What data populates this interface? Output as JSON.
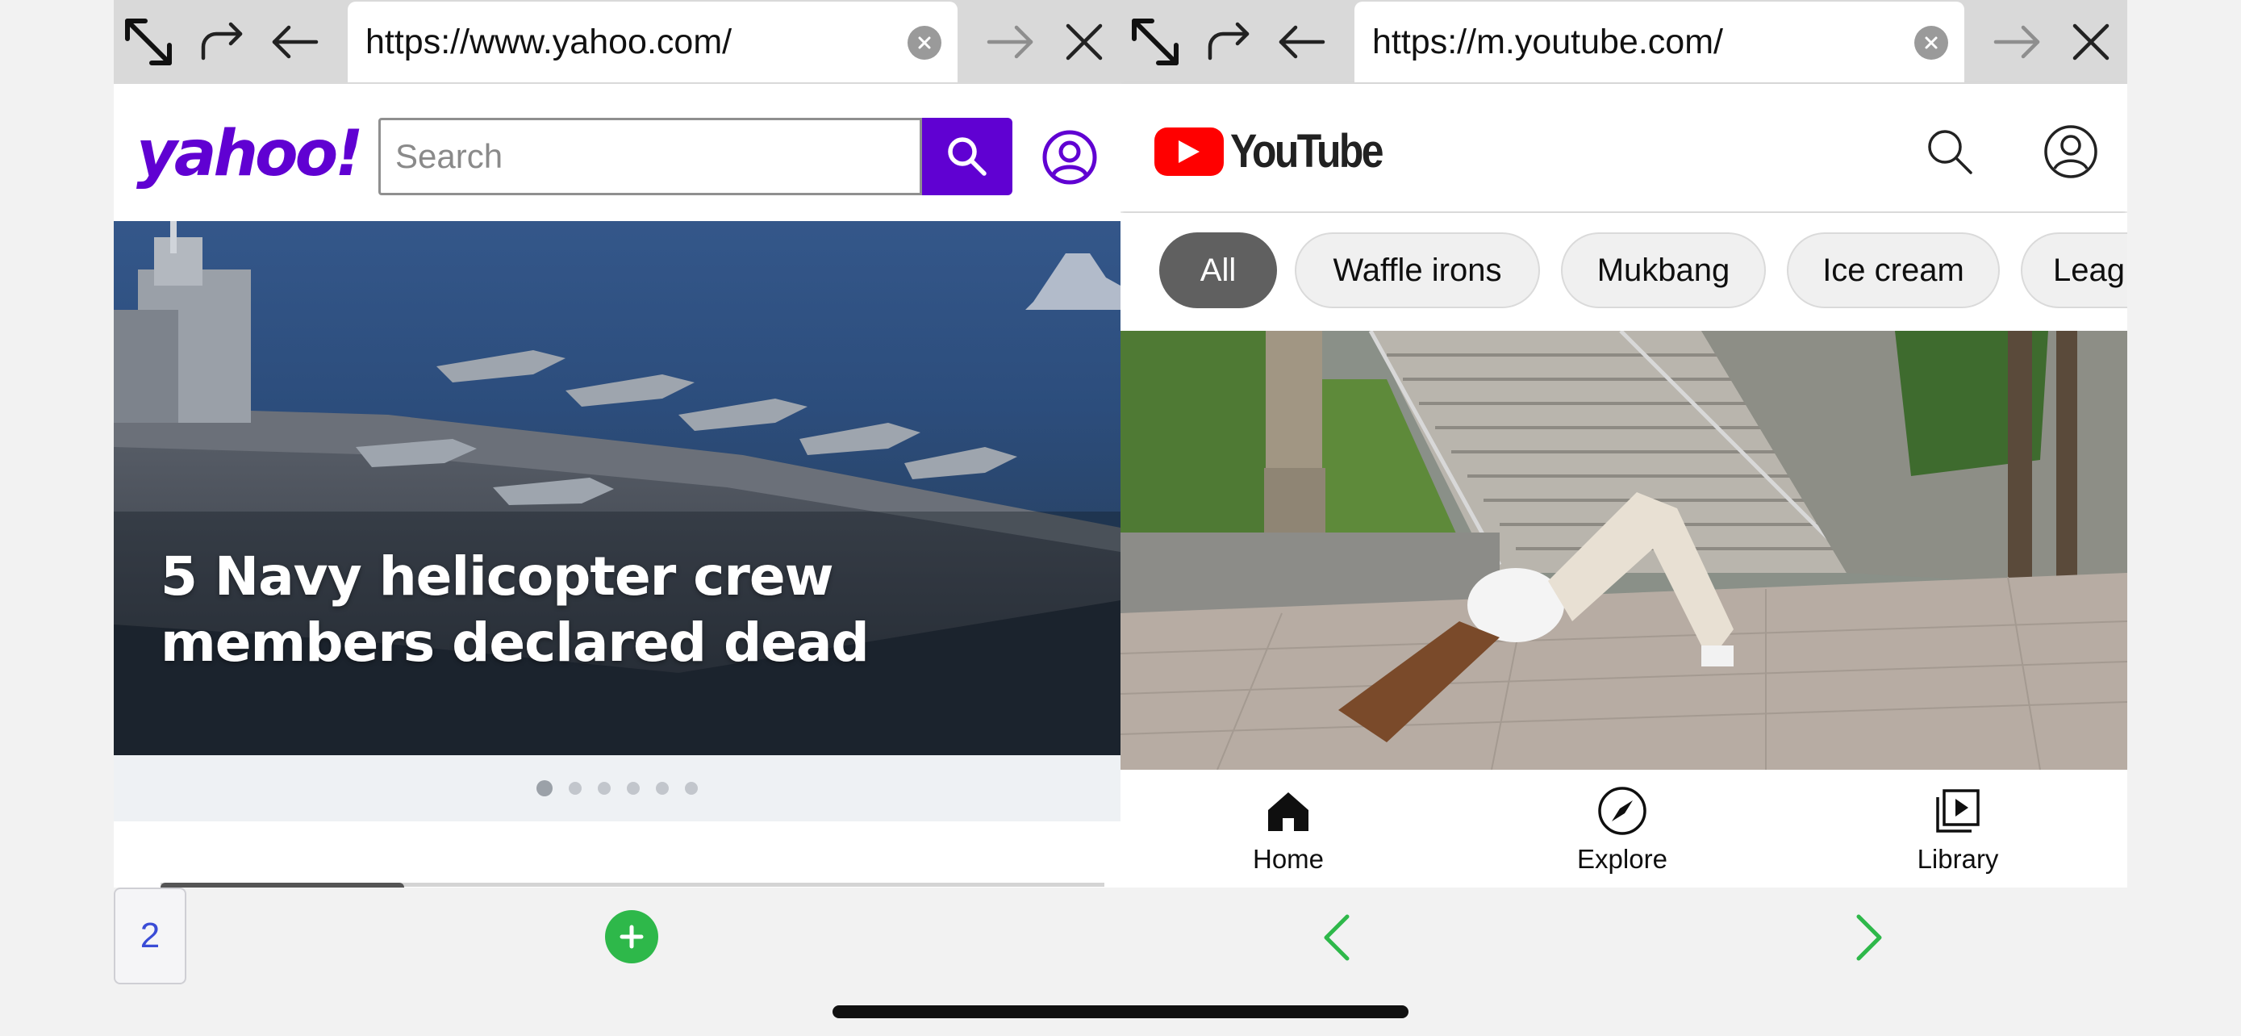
{
  "left_pane": {
    "url": "https://www.yahoo.com/",
    "site": {
      "logo": "yahoo!",
      "search_placeholder": "Search",
      "hero_headline": "5 Navy helicopter crew members declared dead",
      "carousel_count": 6,
      "carousel_active": 1
    }
  },
  "right_pane": {
    "url": "https://m.youtube.com/",
    "site": {
      "logo": "YouTube",
      "chips": [
        "All",
        "Waffle irons",
        "Mukbang",
        "Ice cream",
        "Leag"
      ],
      "active_chip": "All",
      "bottom_nav": {
        "home": "Home",
        "explore": "Explore",
        "library": "Library"
      }
    }
  },
  "toolbar": {
    "tab_count": "2"
  },
  "icons": {
    "browser_bar": [
      "expand-icon",
      "redo-icon",
      "back-arrow-icon",
      "clear-url-icon",
      "forward-arrow-icon",
      "close-icon"
    ],
    "yahoo": [
      "search-icon",
      "account-icon"
    ],
    "youtube": [
      "search-icon",
      "account-icon",
      "home-icon",
      "explore-icon",
      "library-icon"
    ],
    "toolbar": [
      "plus-icon",
      "chevron-left-icon",
      "chevron-right-icon"
    ]
  },
  "colors": {
    "yahoo_purple": "#6001d2",
    "youtube_red": "#ff0000",
    "toolbar_green": "#2eb84a",
    "tab_count_blue": "#3a4cd6",
    "browser_bar_gray": "#d9d9d9"
  }
}
